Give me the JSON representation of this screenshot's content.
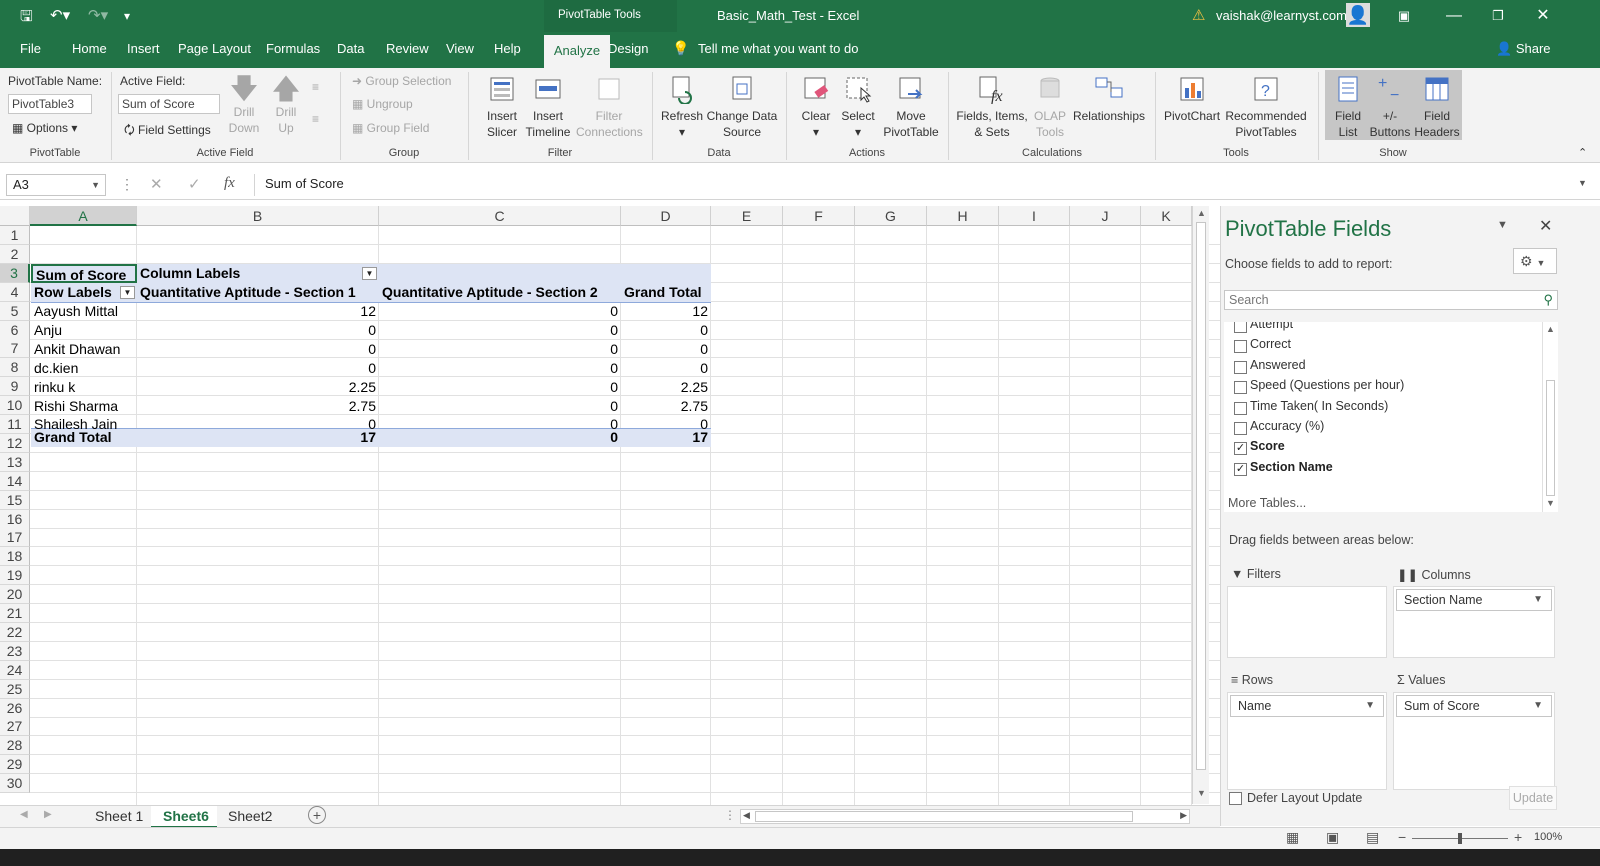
{
  "titlebar": {
    "context_tab": "PivotTable Tools",
    "title": "Basic_Math_Test  -  Excel",
    "user": "vaishak@learnyst.com"
  },
  "tabs": [
    "File",
    "Home",
    "Insert",
    "Page Layout",
    "Formulas",
    "Data",
    "Review",
    "View",
    "Help",
    "Analyze",
    "Design"
  ],
  "tell_me": "Tell me what you want to do",
  "share": "Share",
  "ribbon": {
    "pivot_name_label": "PivotTable Name:",
    "pivot_name_value": "PivotTable3",
    "options": "Options",
    "grp_pivottable": "PivotTable",
    "active_field_label": "Active Field:",
    "active_field_value": "Sum of Score",
    "field_settings": "Field Settings",
    "drill_down": "Drill\nDown",
    "drill_up": "Drill\nUp",
    "grp_active_field": "Active Field",
    "group_selection": "Group Selection",
    "ungroup": "Ungroup",
    "group_field": "Group Field",
    "grp_group": "Group",
    "insert_slicer": "Insert\nSlicer",
    "insert_timeline": "Insert\nTimeline",
    "filter_connections": "Filter\nConnections",
    "grp_filter": "Filter",
    "refresh": "Refresh",
    "change_data_source": "Change Data\nSource",
    "grp_data": "Data",
    "clear": "Clear",
    "select": "Select",
    "move_pivot": "Move\nPivotTable",
    "grp_actions": "Actions",
    "fields_items": "Fields, Items,\n& Sets",
    "olap_tools": "OLAP\nTools",
    "relationships": "Relationships",
    "grp_calculations": "Calculations",
    "pivotchart": "PivotChart",
    "recommended": "Recommended\nPivotTables",
    "grp_tools": "Tools",
    "field_list": "Field\nList",
    "buttons": "+/-\nButtons",
    "field_headers": "Field\nHeaders",
    "grp_show": "Show"
  },
  "formula": {
    "namebox": "A3",
    "fx": "fx",
    "content": "Sum of Score"
  },
  "columns": [
    "A",
    "B",
    "C",
    "D",
    "E",
    "F",
    "G",
    "H",
    "I",
    "J",
    "K"
  ],
  "rows": [
    "1",
    "2",
    "3",
    "4",
    "5",
    "6",
    "7",
    "8",
    "9",
    "10",
    "11",
    "12",
    "13",
    "14",
    "15",
    "16",
    "17",
    "18",
    "19",
    "20",
    "21",
    "22",
    "23",
    "24",
    "25",
    "26",
    "27",
    "28",
    "29",
    "30"
  ],
  "pivot": {
    "corner": "Sum of Score",
    "col_labels": "Column Labels",
    "row_labels": "Row Labels",
    "headers": [
      "Quantitative Aptitude - Section 1",
      "Quantitative Aptitude - Section 2",
      "Grand Total"
    ],
    "data": [
      [
        "Aayush Mittal",
        "12",
        "0",
        "12"
      ],
      [
        "Anju",
        "0",
        "0",
        "0"
      ],
      [
        "Ankit Dhawan",
        "0",
        "0",
        "0"
      ],
      [
        "dc.kien",
        "0",
        "0",
        "0"
      ],
      [
        "rinku k",
        "2.25",
        "0",
        "2.25"
      ],
      [
        "Rishi Sharma",
        "2.75",
        "0",
        "2.75"
      ],
      [
        "Shailesh Jain",
        "0",
        "0",
        "0"
      ]
    ],
    "total": [
      "Grand Total",
      "17",
      "0",
      "17"
    ]
  },
  "panel": {
    "title": "PivotTable Fields",
    "subtitle": "Choose fields to add to report:",
    "search_placeholder": "Search",
    "fields": [
      {
        "label": "Attempt",
        "checked": false
      },
      {
        "label": "Correct",
        "checked": false
      },
      {
        "label": "Answered",
        "checked": false
      },
      {
        "label": "Speed (Questions per hour)",
        "checked": false
      },
      {
        "label": "Time Taken( In Seconds)",
        "checked": false
      },
      {
        "label": "Accuracy (%)",
        "checked": false
      },
      {
        "label": "Score",
        "checked": true
      },
      {
        "label": "Section Name",
        "checked": true
      }
    ],
    "more_tables": "More Tables...",
    "drag_label": "Drag fields between areas below:",
    "filters": "Filters",
    "columns": "Columns",
    "rows": "Rows",
    "values": "Values",
    "columns_pill": "Section Name",
    "rows_pill": "Name",
    "values_pill": "Sum of Score",
    "defer": "Defer Layout Update",
    "update": "Update"
  },
  "sheets": [
    "Sheet 1",
    "Sheet6",
    "Sheet2"
  ],
  "zoom": "100%"
}
